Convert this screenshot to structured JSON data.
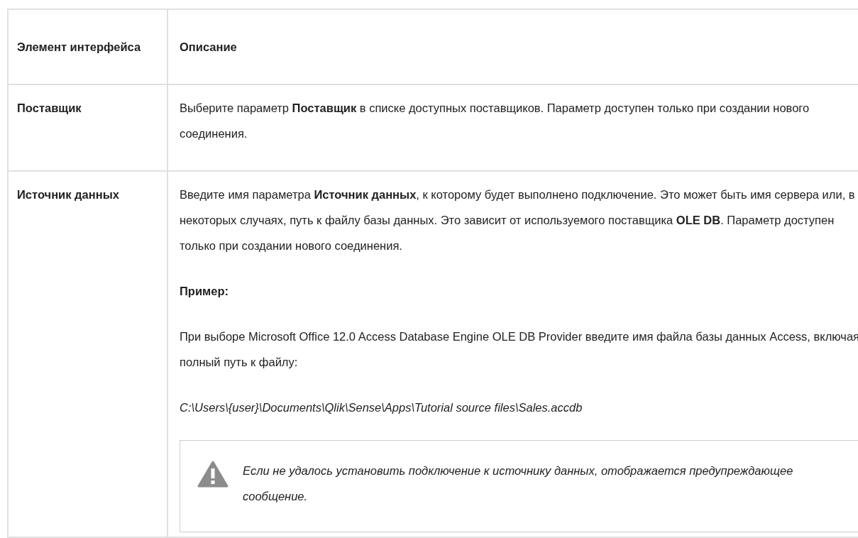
{
  "table": {
    "columns": [
      "Элемент интерфейса",
      "Описание"
    ],
    "rows": [
      {
        "element": "Поставщик",
        "description": [
          {
            "kind": "text",
            "text": "Выберите параметр **Поставщик** в списке доступных поставщиков. Параметр доступен только при создании нового соединения."
          }
        ]
      },
      {
        "element": "Источник данных",
        "description": [
          {
            "kind": "text",
            "text": "Введите имя параметра **Источник данных**, к которому будет выполнено подключение. Это может быть имя сервера или, в некоторых случаях, путь к файлу базы данных. Это зависит от используемого поставщика **OLE DB**. Параметр доступен только при создании нового соединения."
          },
          {
            "kind": "heading",
            "text": "Пример:"
          },
          {
            "kind": "text",
            "text": "При выборе Microsoft Office 12.0 Access Database Engine OLE DB Provider введите имя файла базы данных Access, включая полный путь к файлу:"
          },
          {
            "kind": "path",
            "text": "C:\\Users\\{user}\\Documents\\Qlik\\Sense\\Apps\\Tutorial source files\\Sales.accdb"
          },
          {
            "kind": "warning",
            "text": "Если не удалось установить подключение к источнику данных, отображается предупреждающее сообщение."
          }
        ]
      }
    ]
  }
}
